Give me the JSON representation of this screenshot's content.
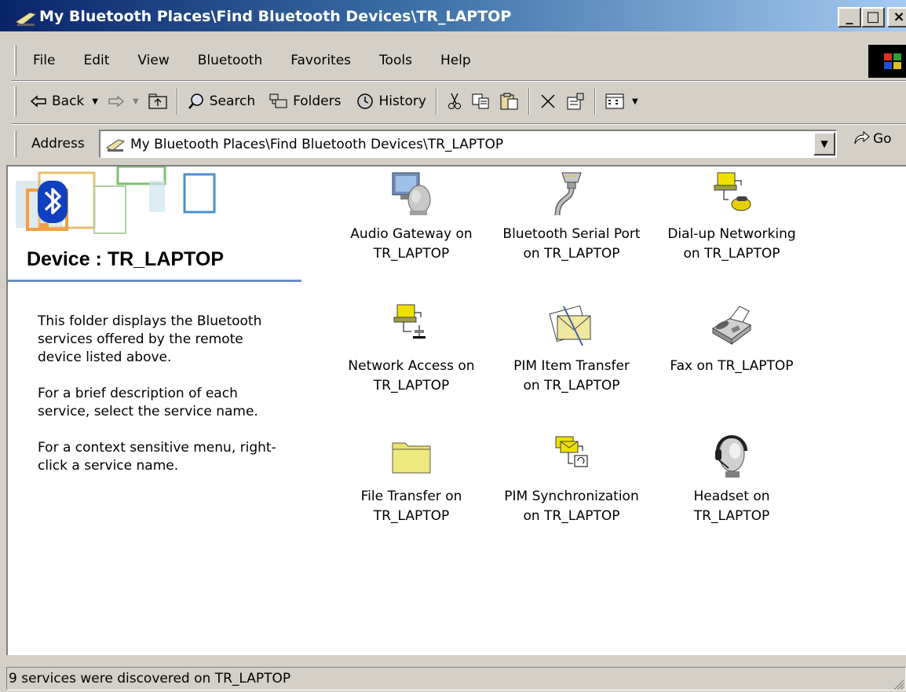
{
  "window": {
    "title": "My Bluetooth Places\\Find Bluetooth Devices\\TR_LAPTOP",
    "minimize": "_",
    "maximize": "□",
    "close": "×"
  },
  "menu": {
    "items": [
      "File",
      "Edit",
      "View",
      "Bluetooth",
      "Favorites",
      "Tools",
      "Help"
    ]
  },
  "toolbar": {
    "back": "Back",
    "search": "Search",
    "folders": "Folders",
    "history": "History"
  },
  "address": {
    "label": "Address",
    "value": "My Bluetooth Places\\Find Bluetooth Devices\\TR_LAPTOP",
    "go": "Go"
  },
  "sidepanel": {
    "title": "Device : TR_LAPTOP",
    "paragraphs": [
      "This folder displays the Bluetooth services offered by the remote device listed above.",
      "For a brief description of each service, select the service name.",
      "For a context sensitive menu, right-click a service name."
    ]
  },
  "services": [
    {
      "icon": "audio-gateway-icon",
      "line1": "Audio Gateway on",
      "line2": "TR_LAPTOP"
    },
    {
      "icon": "serial-port-icon",
      "line1": "Bluetooth Serial Port",
      "line2": "on TR_LAPTOP"
    },
    {
      "icon": "dialup-networking-icon",
      "line1": "Dial-up Networking",
      "line2": "on TR_LAPTOP"
    },
    {
      "icon": "network-access-icon",
      "line1": "Network Access on",
      "line2": "TR_LAPTOP"
    },
    {
      "icon": "pim-transfer-icon",
      "line1": "PIM Item Transfer",
      "line2": "on TR_LAPTOP"
    },
    {
      "icon": "fax-icon",
      "line1": "Fax on TR_LAPTOP",
      "line2": ""
    },
    {
      "icon": "folder-icon",
      "line1": "File Transfer on",
      "line2": "TR_LAPTOP"
    },
    {
      "icon": "pim-sync-icon",
      "line1": "PIM Synchronization",
      "line2": "on TR_LAPTOP"
    },
    {
      "icon": "headset-icon",
      "line1": "Headset on",
      "line2": "TR_LAPTOP"
    }
  ],
  "status": {
    "text": "9 services were discovered on TR_LAPTOP"
  }
}
